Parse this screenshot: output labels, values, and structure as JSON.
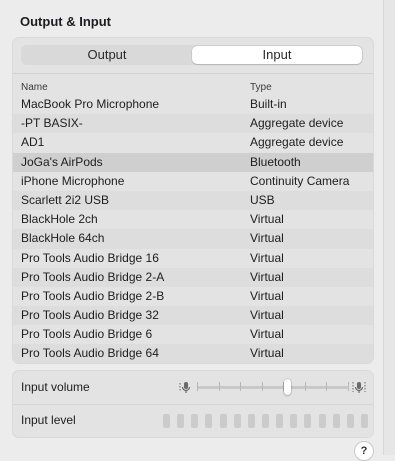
{
  "section": {
    "title": "Output & Input"
  },
  "tabs": [
    {
      "label": "Output",
      "selected": false
    },
    {
      "label": "Input",
      "selected": true
    }
  ],
  "table": {
    "columns": [
      "Name",
      "Type"
    ],
    "selected_index": 3,
    "rows": [
      {
        "name": "MacBook Pro Microphone",
        "type": "Built-in"
      },
      {
        "name": "-PT BASIX-",
        "type": "Aggregate device"
      },
      {
        "name": "AD1",
        "type": "Aggregate device"
      },
      {
        "name": "JoGa's AirPods",
        "type": "Bluetooth"
      },
      {
        "name": "iPhone Microphone",
        "type": "Continuity Camera"
      },
      {
        "name": "Scarlett 2i2 USB",
        "type": "USB"
      },
      {
        "name": "BlackHole 2ch",
        "type": "Virtual"
      },
      {
        "name": "BlackHole 64ch",
        "type": "Virtual"
      },
      {
        "name": "Pro Tools Audio Bridge 16",
        "type": "Virtual"
      },
      {
        "name": "Pro Tools Audio Bridge 2-A",
        "type": "Virtual"
      },
      {
        "name": "Pro Tools Audio Bridge 2-B",
        "type": "Virtual"
      },
      {
        "name": "Pro Tools Audio Bridge 32",
        "type": "Virtual"
      },
      {
        "name": "Pro Tools Audio Bridge 6",
        "type": "Virtual"
      },
      {
        "name": "Pro Tools Audio Bridge 64",
        "type": "Virtual"
      }
    ]
  },
  "input_volume": {
    "label": "Input volume",
    "value": 0.6,
    "icon_low": "mic-low-icon",
    "icon_high": "mic-high-icon"
  },
  "input_level": {
    "label": "Input level",
    "segments": 15,
    "active": 0
  },
  "help": {
    "label": "?"
  },
  "colors": {
    "selected_row": "#cfcfcf",
    "panel": "#e3e3e3",
    "background": "#ececec"
  }
}
